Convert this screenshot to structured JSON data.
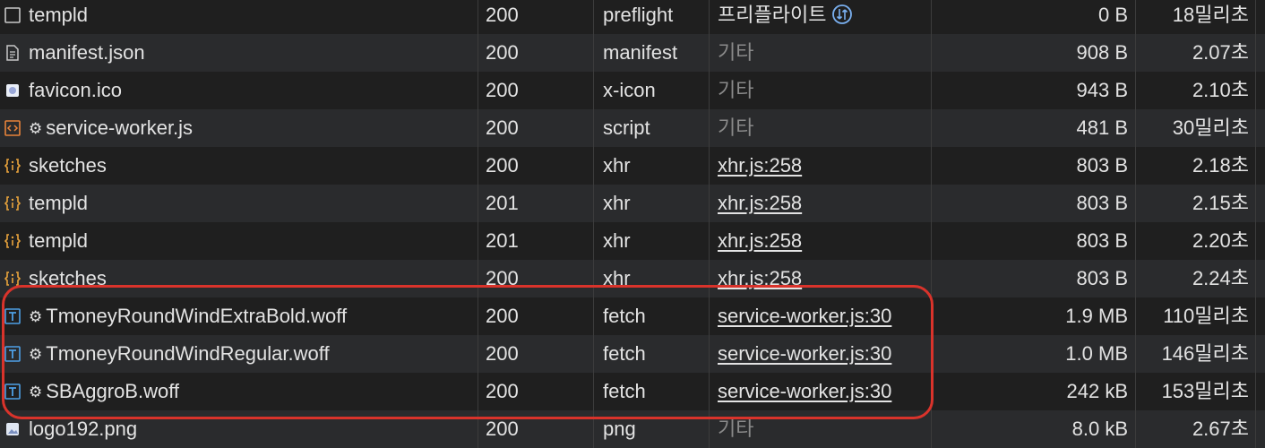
{
  "network": {
    "rows": [
      {
        "icon": "checkbox-icon",
        "gear": false,
        "name": "templd",
        "status": "200",
        "type": "preflight",
        "initiator": "프리플라이트",
        "initiator_link": false,
        "initiator_muted": false,
        "initiator_icon": true,
        "size": "0 B",
        "time": "18밀리초"
      },
      {
        "icon": "document-icon",
        "gear": false,
        "name": "manifest.json",
        "status": "200",
        "type": "manifest",
        "initiator": "기타",
        "initiator_link": false,
        "initiator_muted": true,
        "initiator_icon": false,
        "size": "908 B",
        "time": "2.07초"
      },
      {
        "icon": "favicon-icon",
        "gear": false,
        "name": "favicon.ico",
        "status": "200",
        "type": "x-icon",
        "initiator": "기타",
        "initiator_link": false,
        "initiator_muted": true,
        "initiator_icon": false,
        "size": "943 B",
        "time": "2.10초"
      },
      {
        "icon": "script-icon",
        "gear": true,
        "name": "service-worker.js",
        "status": "200",
        "type": "script",
        "initiator": "기타",
        "initiator_link": false,
        "initiator_muted": true,
        "initiator_icon": false,
        "size": "481 B",
        "time": "30밀리초"
      },
      {
        "icon": "xhr-icon",
        "gear": false,
        "name": "sketches",
        "status": "200",
        "type": "xhr",
        "initiator": "xhr.js:258",
        "initiator_link": true,
        "initiator_muted": false,
        "initiator_icon": false,
        "size": "803 B",
        "time": "2.18초"
      },
      {
        "icon": "xhr-icon",
        "gear": false,
        "name": "templd",
        "status": "201",
        "type": "xhr",
        "initiator": "xhr.js:258",
        "initiator_link": true,
        "initiator_muted": false,
        "initiator_icon": false,
        "size": "803 B",
        "time": "2.15초"
      },
      {
        "icon": "xhr-icon",
        "gear": false,
        "name": "templd",
        "status": "201",
        "type": "xhr",
        "initiator": "xhr.js:258",
        "initiator_link": true,
        "initiator_muted": false,
        "initiator_icon": false,
        "size": "803 B",
        "time": "2.20초"
      },
      {
        "icon": "xhr-icon",
        "gear": false,
        "name": "sketches",
        "status": "200",
        "type": "xhr",
        "initiator": "xhr.js:258",
        "initiator_link": true,
        "initiator_muted": false,
        "initiator_icon": false,
        "size": "803 B",
        "time": "2.24초"
      },
      {
        "icon": "font-icon",
        "gear": true,
        "name": "TmoneyRoundWindExtraBold.woff",
        "status": "200",
        "type": "fetch",
        "initiator": "service-worker.js:30",
        "initiator_link": true,
        "initiator_muted": false,
        "initiator_icon": false,
        "size": "1.9 MB",
        "time": "110밀리초"
      },
      {
        "icon": "font-icon",
        "gear": true,
        "name": "TmoneyRoundWindRegular.woff",
        "status": "200",
        "type": "fetch",
        "initiator": "service-worker.js:30",
        "initiator_link": true,
        "initiator_muted": false,
        "initiator_icon": false,
        "size": "1.0 MB",
        "time": "146밀리초"
      },
      {
        "icon": "font-icon",
        "gear": true,
        "name": "SBAggroB.woff",
        "status": "200",
        "type": "fetch",
        "initiator": "service-worker.js:30",
        "initiator_link": true,
        "initiator_muted": false,
        "initiator_icon": false,
        "size": "242 kB",
        "time": "153밀리초"
      },
      {
        "icon": "image-icon",
        "gear": false,
        "name": "logo192.png",
        "status": "200",
        "type": "png",
        "initiator": "기타",
        "initiator_link": false,
        "initiator_muted": true,
        "initiator_icon": false,
        "size": "8.0 kB",
        "time": "2.67초"
      }
    ]
  },
  "gear_glyph": "⚙",
  "colors": {
    "annotation_outline": "#d9332b",
    "xhr_icon": "#e8a33c",
    "script_icon": "#e8833a",
    "font_icon": "#4ea0e6"
  }
}
